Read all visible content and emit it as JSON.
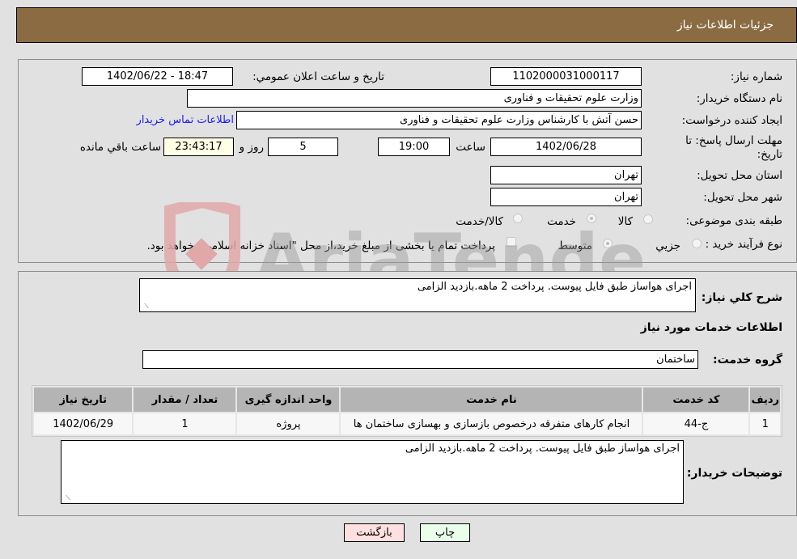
{
  "header": {
    "title": "جزئیات اطلاعات نیاز"
  },
  "form": {
    "need_number_label": "شماره نیاز:",
    "need_number": "1102000031000117",
    "announce_label": "تاریخ و ساعت اعلان عمومي:",
    "announce_value": "1402/06/22 - 18:47",
    "buyer_org_label": "نام دستگاه خريدار:",
    "buyer_org": "وزارت علوم  تحقیقات و فناوری",
    "requester_label": "ایجاد کننده درخواست:",
    "requester": "حسن آتش با کارشناس وزارت علوم  تحقیقات و فناوری",
    "contact_link": "اطلاعات تماس خریدار",
    "deadline_label_line1": "مهلت ارسال پاسخ: تا",
    "deadline_label_line2": "تاریخ:",
    "deadline_date": "1402/06/28",
    "time_label": "ساعت",
    "deadline_time": "19:00",
    "days_value": "5",
    "days_label": "روز و",
    "remaining_time": "23:43:17",
    "remaining_label": "ساعت باقي مانده",
    "province_label": "استان محل تحویل:",
    "province": "تهران",
    "city_label": "شهر محل تحویل:",
    "city": "تهران",
    "category_label": "طبقه بندی موضوعی:",
    "category_options": [
      {
        "label": "کالا",
        "checked": false
      },
      {
        "label": "خدمت",
        "checked": true
      },
      {
        "label": "کالا/خدمت",
        "checked": false
      }
    ],
    "process_label": "نوع فرآیند خرید :",
    "process_options": [
      {
        "label": "جزيي",
        "checked": false
      },
      {
        "label": "متوسط",
        "checked": true
      }
    ],
    "treasury_note": "پرداخت تمام یا بخشی از مبلغ خرید،از محل \"اسناد خزانه اسلامی\" خواهد بود.",
    "treasury_checked": false
  },
  "details": {
    "description_label": "شرح کلي نياز:",
    "description": "اجرای هواساز طبق فایل پیوست. پرداخت 2 ماهه.بازدید الزامی",
    "services_heading": "اطلاعات خدمات مورد نیاز",
    "service_group_label": "گروه خدمت:",
    "service_group": "ساختمان",
    "table": {
      "headers": [
        "ردیف",
        "کد خدمت",
        "نام خدمت",
        "واحد اندازه گیری",
        "تعداد / مقدار",
        "تاریخ نیاز"
      ],
      "rows": [
        [
          "1",
          "ج-44",
          "انجام کارهای متفرقه درخصوص بازسازی و بهسازی ساختمان ها",
          "پروژه",
          "1",
          "1402/06/29"
        ]
      ]
    },
    "buyer_notes_label": "توضیحات خریدار:",
    "buyer_notes": "اجرای هواساز طبق فایل پیوست. پرداخت 2 ماهه.بازدید الزامی"
  },
  "buttons": {
    "print": "چاپ",
    "back": "بازگشت",
    "print_color": "#eaffea",
    "back_color": "#ffe0e0"
  },
  "watermark": {
    "text": "AriaTender.neT"
  }
}
